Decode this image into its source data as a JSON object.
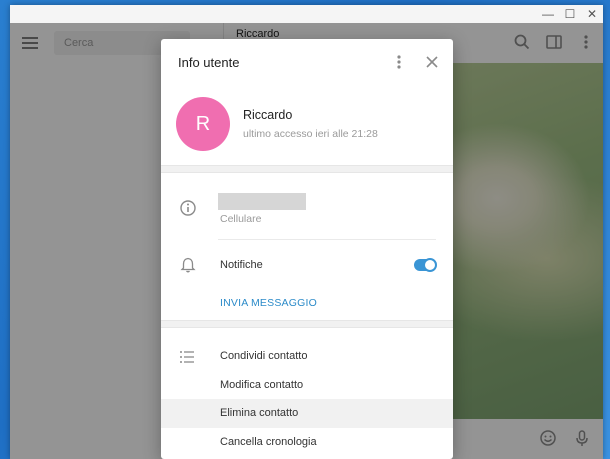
{
  "window": {
    "controls": {
      "minimize": "—",
      "maximize": "☐",
      "close": "✕"
    }
  },
  "left_panel": {
    "search_placeholder": "Cerca"
  },
  "chat": {
    "name": "Riccardo"
  },
  "modal": {
    "title": "Info utente",
    "user": {
      "initial": "R",
      "name": "Riccardo",
      "status": "ultimo accesso ieri alle 21:28",
      "avatar_color": "#f06eb0"
    },
    "phone_label": "Cellulare",
    "notifications_label": "Notifiche",
    "notifications_enabled": true,
    "send_message": "INVIA MESSAGGIO",
    "actions": [
      {
        "label": "Condividi contatto"
      },
      {
        "label": "Modifica contatto"
      },
      {
        "label": "Elimina contatto"
      },
      {
        "label": "Cancella cronologia"
      }
    ]
  },
  "colors": {
    "accent": "#3a95d5",
    "link": "#2c8bc9",
    "avatar": "#f06eb0"
  }
}
